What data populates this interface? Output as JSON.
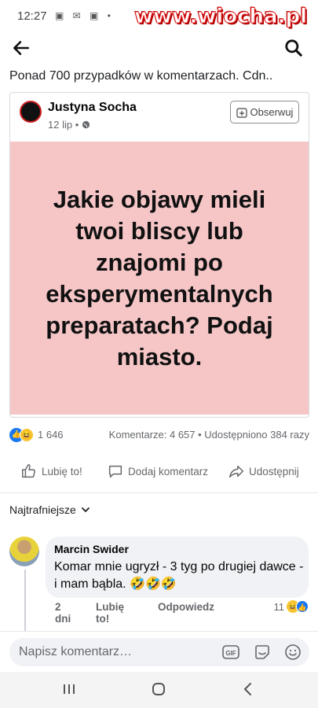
{
  "status_bar": {
    "time": "12:27",
    "icons": "▣ ✉ ▣ •",
    "watermark": "www.wiocha.pl"
  },
  "header": {
    "back_icon": "arrow-left-icon",
    "search_icon": "search-icon"
  },
  "share_text": "Ponad 700 przypadków w komentarzach. Cdn..",
  "post": {
    "author": "Justyna Socha",
    "date": "12 lip •",
    "follow_label": "Obserwuj",
    "image_text": "Jakie objawy mieli twoi bliscy lub znajomi po eksperymentalnych preparatach? Podaj miasto.",
    "image_bg": "#f6c6c7"
  },
  "stats": {
    "reactions_count": "1 646",
    "comments_shares": "Komentarze: 4 657 • Udostępniono 384 razy"
  },
  "actions": {
    "like": "Lubię to!",
    "comment": "Dodaj komentarz",
    "share": "Udostępnij"
  },
  "sort": {
    "label": "Najtrafniejsze"
  },
  "comment": {
    "author": "Marcin Swider",
    "text": "Komar mnie ugryzł - 3 tyg po drugiej dawce - i mam bąbla. 🤣🤣🤣",
    "time": "2 dni",
    "like": "Lubię to!",
    "reply": "Odpowiedz",
    "reaction_count": "11"
  },
  "composer": {
    "placeholder": "Napisz komentarz…",
    "gif_label": "GIF"
  },
  "colors": {
    "accent": "#1877f2",
    "text_secondary": "#65676b",
    "bubble_bg": "#f0f2f5"
  }
}
